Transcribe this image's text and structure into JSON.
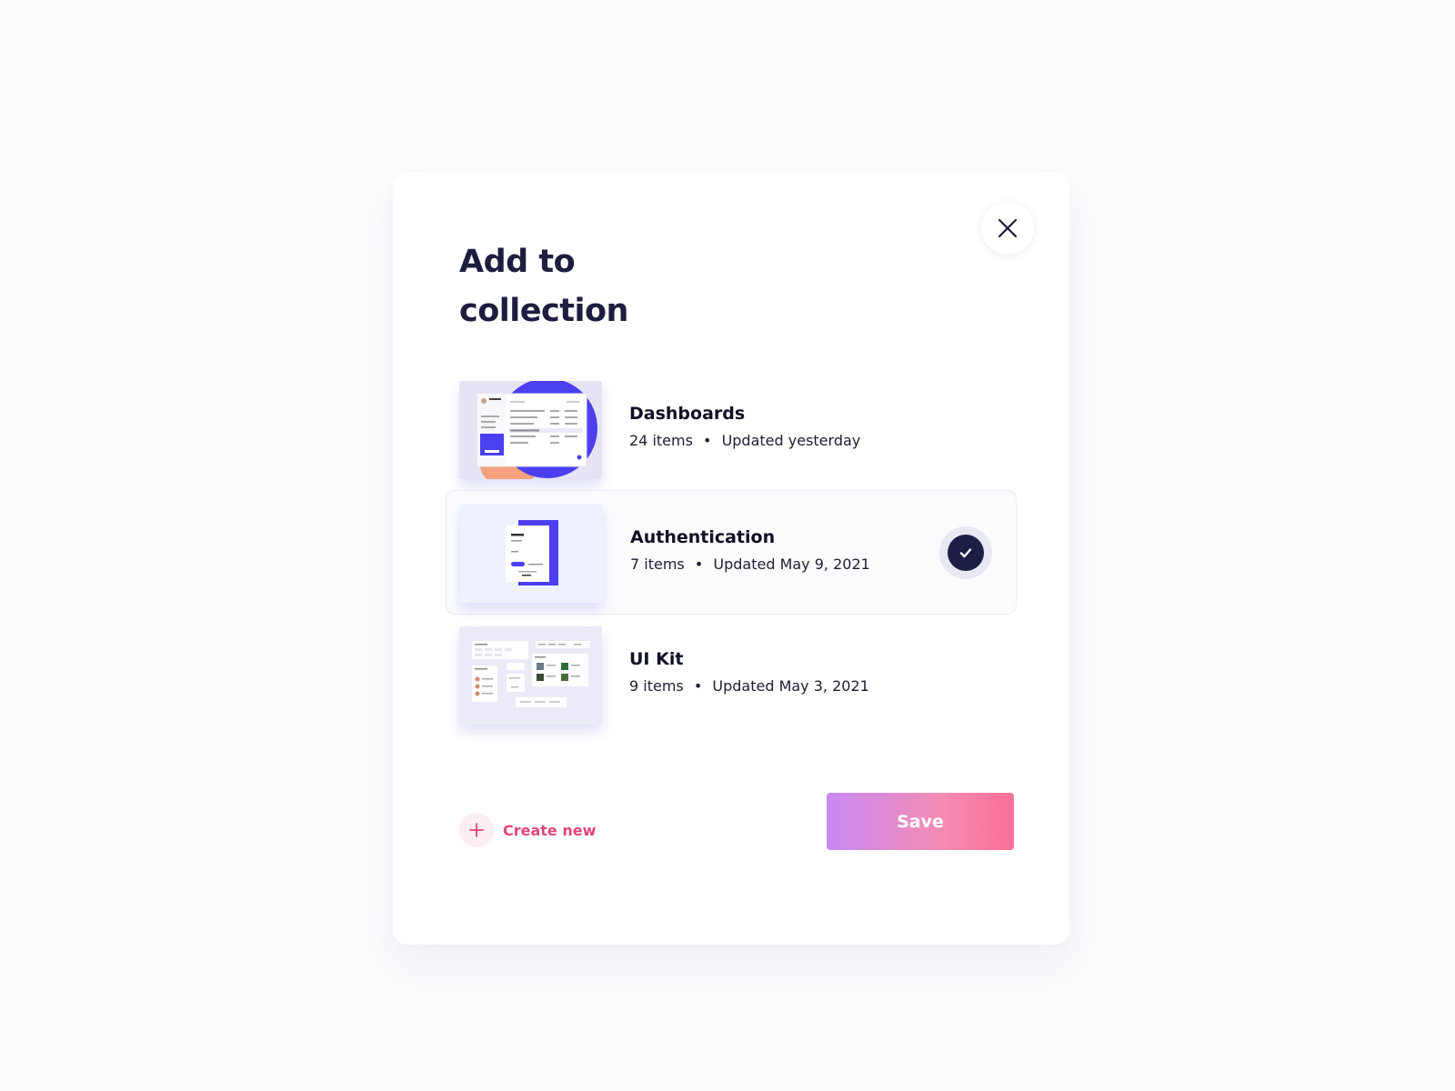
{
  "modal": {
    "title": "Add to collection",
    "close_icon": "close-icon"
  },
  "collections": [
    {
      "name": "Dashboards",
      "count": "24 items",
      "updated": "Updated yesterday",
      "selected": false,
      "thumbnail": "dashboard-preview"
    },
    {
      "name": "Authentication",
      "count": "7 items",
      "updated": "Updated May 9, 2021",
      "selected": true,
      "thumbnail": "sign-in-preview"
    },
    {
      "name": "UI Kit",
      "count": "9 items",
      "updated": "Updated May 3, 2021",
      "selected": false,
      "thumbnail": "ui-kit-preview"
    }
  ],
  "separator": "•",
  "footer": {
    "create_label": "Create new",
    "create_icon": "plus-icon",
    "save_label": "Save"
  },
  "colors": {
    "title": "#1d1d3f",
    "accent_pink": "#e0467a",
    "check_dark": "#1d1e46",
    "save_gradient_start": "#c88af4",
    "save_gradient_end": "#fd6f97",
    "thumb_blue": "#4b3ff0",
    "thumb_orange": "#f4a07e"
  }
}
